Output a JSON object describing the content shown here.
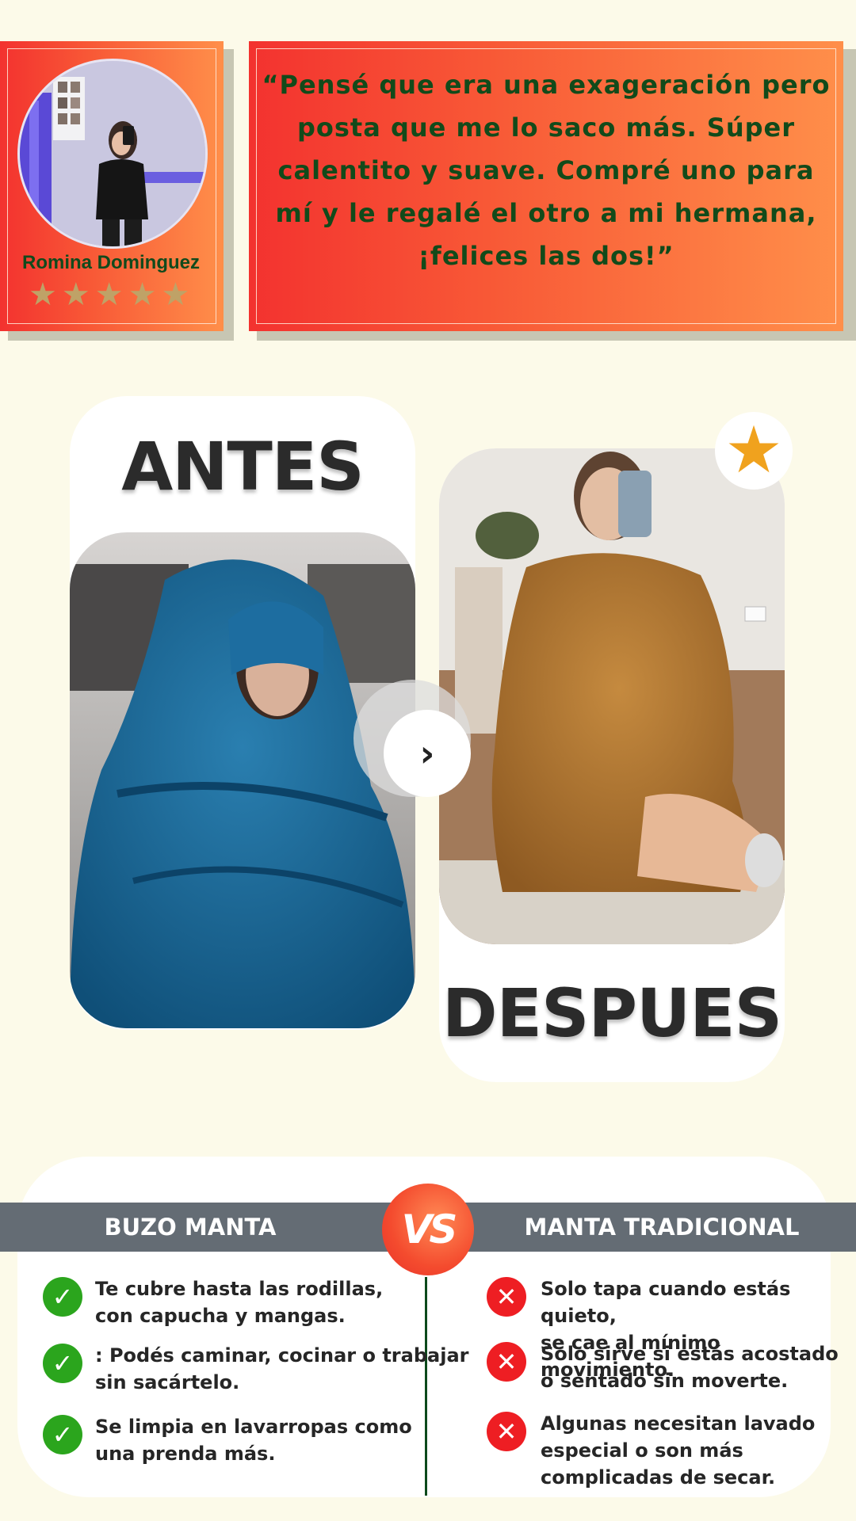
{
  "testimonial": {
    "reviewer_name": "Romina Dominguez",
    "rating_stars": [
      "★",
      "★",
      "★",
      "★",
      "★"
    ],
    "rating_value": 5,
    "star_color": "#bfa267",
    "quote": "“Pensé que era una exageración pero posta que me lo saco más. Súper calentito y suave. Compré uno para mí y le regalé el otro a mi hermana, ¡felices las dos!”"
  },
  "before_after": {
    "before_label": "ANTES",
    "after_label": "DESPUES",
    "arrow_icon": "chevron-right-icon",
    "arrow_glyph": "›",
    "badge_icon": "star-icon",
    "badge_glyph": "★",
    "badge_color": "#f0a21e"
  },
  "comparison": {
    "left_title": "BUZO MANTA",
    "right_title": "MANTA TRADICIONAL",
    "vs_label": "VS",
    "check_glyph": "✓",
    "cross_glyph": "✕",
    "left_items": [
      "Te cubre hasta las rodillas,\ncon capucha y mangas.",
      ": Podés caminar, cocinar o trabajar\nsin sacártelo.",
      "Se limpia en lavarropas como\nuna prenda más."
    ],
    "right_items": [
      "Solo tapa cuando estás quieto,\nse cae al mínimo movimiento.",
      "Solo sirve si estás acostado\no sentado sin moverte.",
      "Algunas necesitan lavado\nespecial o son más\ncomplicadas de secar."
    ],
    "colors": {
      "header": "#646c74",
      "check": "#2ba51d",
      "cross": "#ee1e23",
      "vs": "#f44b2e"
    }
  }
}
